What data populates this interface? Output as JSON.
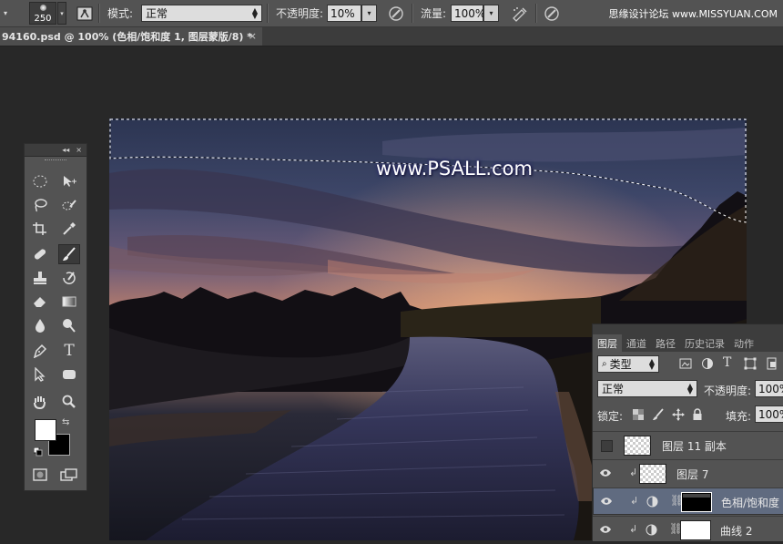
{
  "options_bar": {
    "brush_size": "250",
    "mode_label": "模式:",
    "mode_value": "正常",
    "opacity_label": "不透明度:",
    "opacity_value": "10%",
    "flow_label": "流量:",
    "flow_value": "100%",
    "site_credit": "思缘设计论坛 www.MISSYUAN.COM"
  },
  "document_tab": {
    "title": "94160.psd @ 100% (色相/饱和度 1, 图层蒙版/8) *",
    "close": "×"
  },
  "canvas": {
    "watermark": "www.PSALL.com"
  },
  "tools_panel": {
    "collapse": "◂◂",
    "close": "×"
  },
  "layers_panel": {
    "tabs": [
      "图层",
      "通道",
      "路径",
      "历史记录",
      "动作"
    ],
    "filter_kind": "类型",
    "blend_mode": "正常",
    "opacity_label": "不透明度:",
    "opacity_value": "100%",
    "lock_label": "锁定:",
    "fill_label": "填充:",
    "fill_value": "100%",
    "layers": [
      {
        "name": "图层 11 副本",
        "visible": false,
        "clipped": false,
        "type": "pixel",
        "selected": false
      },
      {
        "name": "图层 7",
        "visible": true,
        "clipped": true,
        "type": "pixel",
        "selected": false
      },
      {
        "name": "色相/饱和度",
        "visible": true,
        "clipped": true,
        "type": "adjustment",
        "selected": true
      },
      {
        "name": "曲线 2",
        "visible": true,
        "clipped": true,
        "type": "adjustment",
        "selected": false
      }
    ]
  },
  "colors": {
    "foreground": "#ffffff",
    "background": "#000000",
    "ui_panel": "#535353",
    "selection_highlight": "#606b80"
  }
}
